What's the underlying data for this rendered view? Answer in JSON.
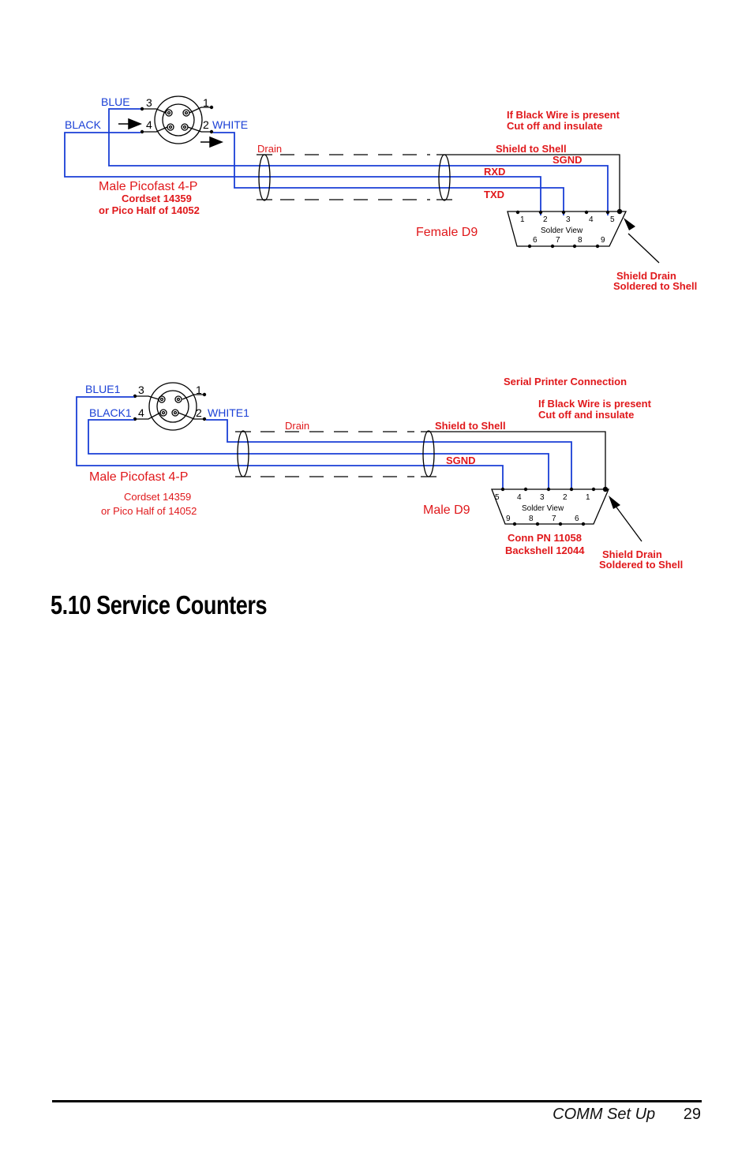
{
  "diagram1": {
    "wire_labels": {
      "blue": "BLUE",
      "black": "BLACK",
      "white": "WHITE"
    },
    "pins": [
      "3",
      "1",
      "4",
      "2"
    ],
    "connector_title": "Male Picofast 4-P",
    "cordset": "Cordset 14359",
    "pico_half": "or Pico Half of 14052",
    "drain": "Drain",
    "note_line1": "If Black Wire is present",
    "note_line2": "Cut off and insulate",
    "shield_to_shell": "Shield to Shell",
    "sgnd": "SGND",
    "rxd": "RXD",
    "txd": "TXD",
    "d9_label": "Female D9",
    "solder_view": "Solder View",
    "d9_top_pins": [
      "1",
      "2",
      "3",
      "4",
      "5"
    ],
    "d9_bottom_pins": [
      "6",
      "7",
      "8",
      "9"
    ],
    "shield_drain_line1": "Shield Drain",
    "shield_drain_line2": "Soldered to Shell"
  },
  "diagram2": {
    "wire_labels": {
      "blue": "BLUE1",
      "black": "BLACK1",
      "white": "WHITE1"
    },
    "pins": [
      "3",
      "1",
      "4",
      "2"
    ],
    "connector_title": "Male Picofast 4-P",
    "cordset": "Cordset 14359",
    "pico_half": "or Pico Half of 14052",
    "drain": "Drain",
    "title": "Serial Printer Connection",
    "note_line1": "If Black Wire is present",
    "note_line2": "Cut off and insulate",
    "shield_to_shell": "Shield to Shell",
    "sgnd": "SGND",
    "d9_label": "Male D9",
    "solder_view": "Solder View",
    "d9_top_pins": [
      "5",
      "4",
      "3",
      "2",
      "1"
    ],
    "d9_bottom_pins": [
      "9",
      "8",
      "7",
      "6"
    ],
    "conn_pn": "Conn PN 11058",
    "backshell": "Backshell 12044",
    "shield_drain_line1": "Shield Drain",
    "shield_drain_line2": "Soldered to Shell"
  },
  "section": {
    "heading": "5.10 Service Counters"
  },
  "footer": {
    "section": "COMM Set Up",
    "page": "29"
  },
  "colors": {
    "wire_blue": "#1a3fd6",
    "label_red": "#e0181b",
    "label_blue": "#1a3fd6"
  }
}
